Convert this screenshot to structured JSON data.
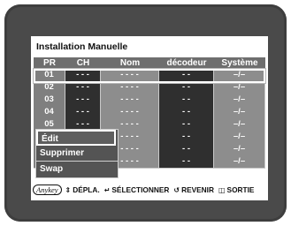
{
  "title": "Installation Manuelle",
  "columns": [
    "PR",
    "CH",
    "Nom",
    "décodeur",
    "Système"
  ],
  "rows": [
    {
      "pr": "01",
      "ch": "- - -",
      "nom": "- - - -",
      "dec": "- -",
      "sys": "–/–"
    },
    {
      "pr": "02",
      "ch": "- - -",
      "nom": "- - - -",
      "dec": "- -",
      "sys": "–/–"
    },
    {
      "pr": "03",
      "ch": "- - -",
      "nom": "- - - -",
      "dec": "- -",
      "sys": "–/–"
    },
    {
      "pr": "04",
      "ch": "- - -",
      "nom": "- - - -",
      "dec": "- -",
      "sys": "–/–"
    },
    {
      "pr": "05",
      "ch": "- - -",
      "nom": "- - - -",
      "dec": "- -",
      "sys": "–/–"
    },
    {
      "pr": "06",
      "ch": "- - -",
      "nom": "- - - -",
      "dec": "- -",
      "sys": "–/–"
    },
    {
      "pr": "07",
      "ch": "- - -",
      "nom": "- - - -",
      "dec": "- -",
      "sys": "–/–"
    },
    {
      "pr": "08",
      "ch": "- - -",
      "nom": "- - - -",
      "dec": "- -",
      "sys": "–/–"
    }
  ],
  "popup": {
    "items": [
      "Édit",
      "Supprimer",
      "Swap"
    ]
  },
  "footer": {
    "anykey": "Anykey",
    "move_icon": "up-down-arrows-icon",
    "move_label": "DÉPLA.",
    "select_icon": "enter-icon",
    "select_label": "SÉLECTIONNER",
    "return_icon": "return-arrow-icon",
    "return_label": "REVENIR",
    "exit_icon": "exit-icon",
    "exit_label": "SORTIE"
  },
  "colors": {
    "tv_frame": "#4a4a4a",
    "screen_bg": "#ffffff",
    "header_bg": "#6e6e6e",
    "popup_bg": "#545454"
  }
}
